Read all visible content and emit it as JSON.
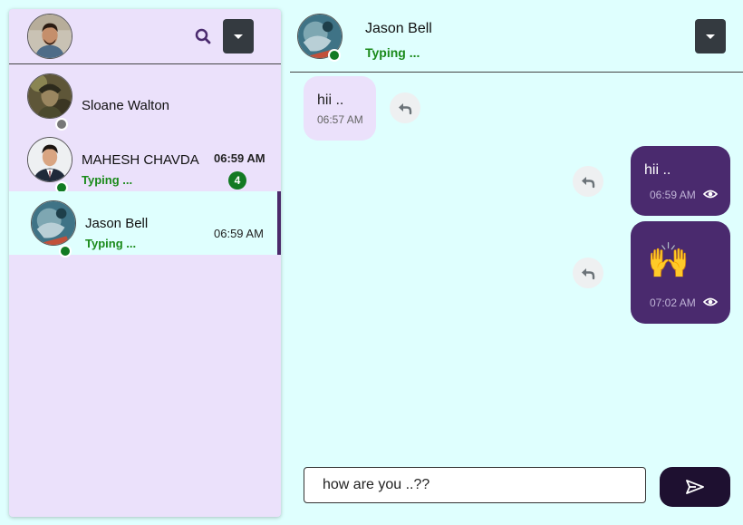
{
  "sidebar": {
    "contacts": [
      {
        "name": "Sloane Walton",
        "status": "offline"
      },
      {
        "name": "MAHESH CHAVDA",
        "typing": "Typing ...",
        "time": "06:59 AM",
        "unread": "4",
        "status": "online"
      },
      {
        "name": "Jason Bell",
        "typing": "Typing ...",
        "time": "06:59 AM",
        "status": "online",
        "active": true
      }
    ]
  },
  "chat": {
    "contact_name": "Jason Bell",
    "typing": "Typing ...",
    "messages": [
      {
        "direction": "in",
        "text": "hii ..",
        "time": "06:57 AM"
      },
      {
        "direction": "out",
        "text": "hii ..",
        "time": "06:59 AM",
        "seen_icon": "eye-icon"
      },
      {
        "direction": "out",
        "text": "🙌",
        "time": "07:02 AM",
        "seen_icon": "eye-icon"
      }
    ],
    "input_value": "how are you ..??"
  },
  "colors": {
    "page_bg": "#dffffe",
    "sidebar_bg": "#ebe1fb",
    "outgoing_bubble": "#4a2a6e",
    "incoming_bubble": "#ebe1fb",
    "online": "#137a23",
    "offline": "#777777",
    "typing_text": "#1a8a1a",
    "send_button": "#1e1030"
  }
}
